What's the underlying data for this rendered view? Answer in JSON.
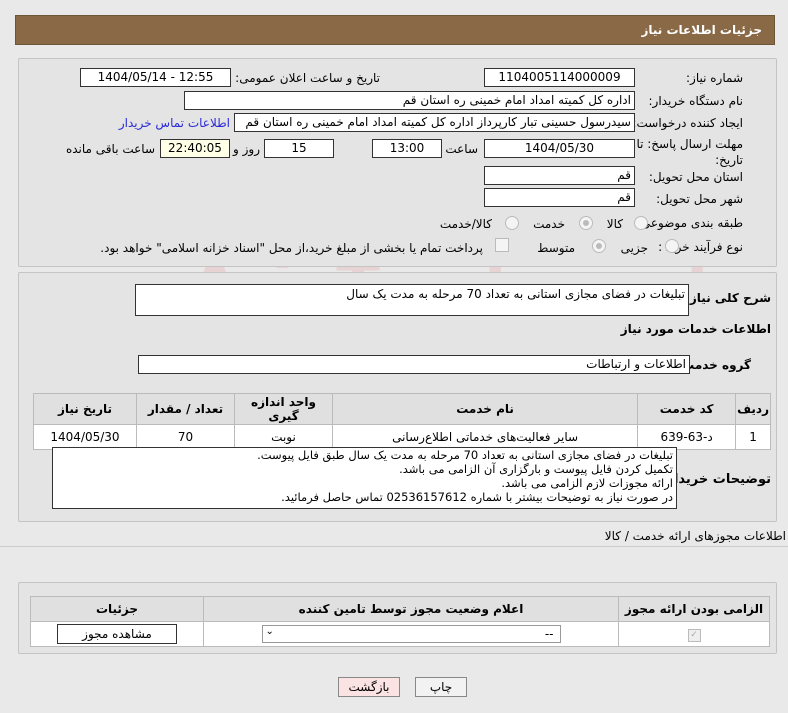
{
  "header": {
    "title": "جزئیات اطلاعات نیاز"
  },
  "info": {
    "need_number_label": "شماره نیاز:",
    "need_number": "1104005114000009",
    "announce_label": "تاریخ و ساعت اعلان عمومی:",
    "announce_value": "1404/05/14 - 12:55",
    "buyer_label": "نام دستگاه خریدار:",
    "buyer_value": "اداره کل کمیته امداد امام خمینی  ره  استان قم",
    "creator_label": "ایجاد کننده درخواست:",
    "creator_value": "سیدرسول حسینی تبار کارپرداز اداره کل کمیته امداد امام خمینی  ره  استان قم",
    "contact_link": "اطلاعات تماس خریدار",
    "deadline_label": "مهلت ارسال پاسخ: تا تاریخ:",
    "deadline_date": "1404/05/30",
    "time_label": "ساعت",
    "deadline_time": "13:00",
    "days": "15",
    "days_label": "روز و",
    "remaining": "22:40:05",
    "remaining_label": "ساعت باقی مانده",
    "province_label": "استان محل تحویل:",
    "province": "قم",
    "city_label": "شهر محل تحویل:",
    "city": "قم",
    "category_label": "طبقه بندی موضوعی:",
    "cat_options": [
      "کالا",
      "خدمت",
      "کالا/خدمت"
    ],
    "process_label": "نوع فرآیند خرید :",
    "process_options": [
      "جزیی",
      "متوسط"
    ],
    "payment_text": "پرداخت تمام یا بخشی از مبلغ خرید،از محل \"اسناد خزانه اسلامی\" خواهد بود."
  },
  "details": {
    "summary_label": "شرح کلی نیاز:",
    "summary": "تبلیغات در فضای مجازی استانی به تعداد 70 مرحله به مدت یک سال",
    "services_title": "اطلاعات خدمات مورد نیاز",
    "group_label": "گروه خدمت:",
    "group": "اطلاعات و ارتباطات",
    "table_headers": [
      "ردیف",
      "کد خدمت",
      "نام خدمت",
      "واحد اندازه گیری",
      "تعداد / مقدار",
      "تاریخ نیاز"
    ],
    "rows": [
      [
        "1",
        "د-63-639",
        "سایر فعالیت‌های خدماتی اطلاع‌رسانی",
        "نوبت",
        "70",
        "1404/05/30"
      ]
    ],
    "buyer_notes_label": "توضیحات خریدار:",
    "buyer_notes": [
      "تبلیغات در فضای مجازی استانی به تعداد 70 مرحله به مدت یک سال طبق فایل پیوست.",
      "تکمیل کردن فایل پیوست و بارگزاری آن الزامی می باشد.",
      "ارائه مجوزات لازم الزامی می باشد.",
      "در صورت نیاز به توضیحات بیشتر با شماره 02536157612 تماس حاصل فرمائید."
    ]
  },
  "permits": {
    "title": "اطلاعات مجوزهای ارائه خدمت / کالا",
    "headers": [
      "الزامی بودن ارائه مجوز",
      "اعلام وضعیت مجوز توسط تامین کننده",
      "جزئیات"
    ],
    "select_value": "--",
    "view_button": "مشاهده مجوز"
  },
  "footer": {
    "print": "چاپ",
    "back": "بازگشت"
  },
  "watermark": "AriaTender.net"
}
